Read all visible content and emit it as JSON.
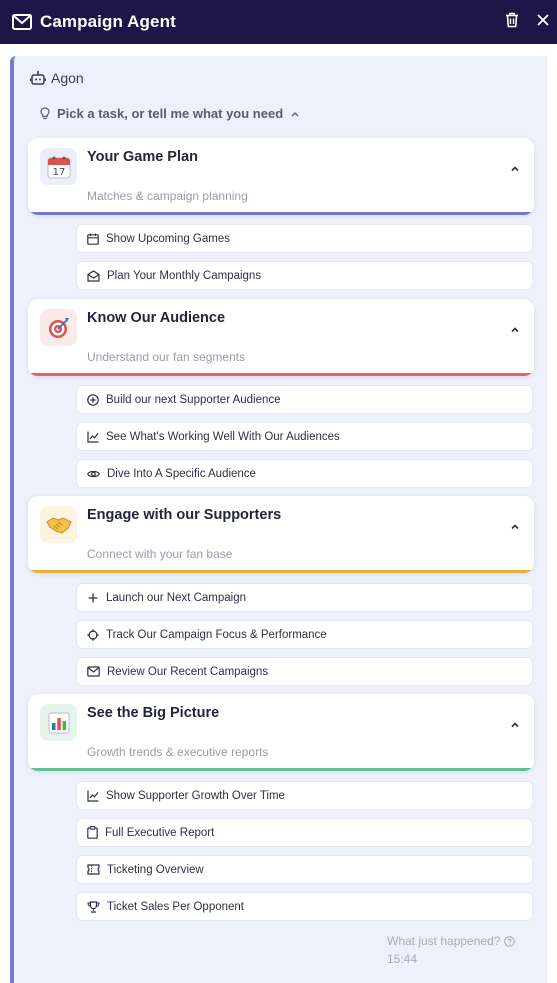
{
  "header": {
    "title": "Campaign Agent"
  },
  "agent": {
    "name": "Agon"
  },
  "picker": {
    "label": "Pick a task, or tell me what you need"
  },
  "sections": [
    {
      "title": "Your Game Plan",
      "subtitle": "Matches & campaign planning",
      "accent": "#7679d4",
      "icon": "calendar-icon",
      "items": [
        {
          "label": "Show Upcoming Games",
          "icon": "calendar-icon"
        },
        {
          "label": "Plan Your Monthly Campaigns",
          "icon": "mail-open-icon"
        }
      ]
    },
    {
      "title": "Know Our Audience",
      "subtitle": "Understand our fan segments",
      "accent": "#e0606b",
      "icon": "target-icon",
      "items": [
        {
          "label": "Build our next Supporter Audience",
          "icon": "plus-circle-icon"
        },
        {
          "label": "See What's Working Well With Our Audiences",
          "icon": "line-chart-icon"
        },
        {
          "label": "Dive Into A Specific Audience",
          "icon": "eye-icon"
        }
      ]
    },
    {
      "title": "Engage with our Supporters",
      "subtitle": "Connect with your fan base",
      "accent": "#e9b040",
      "icon": "handshake-icon",
      "items": [
        {
          "label": "Launch our Next Campaign",
          "icon": "plus-icon"
        },
        {
          "label": "Track Our Campaign Focus & Performance",
          "icon": "crosshair-icon"
        },
        {
          "label": "Review Our Recent Campaigns",
          "icon": "mail-icon"
        }
      ]
    },
    {
      "title": "See the Big Picture",
      "subtitle": "Growth trends & executive reports",
      "accent": "#5cc28e",
      "icon": "bar-chart-icon",
      "items": [
        {
          "label": "Show Supporter Growth Over Time",
          "icon": "line-chart-icon"
        },
        {
          "label": "Full Executive Report",
          "icon": "clipboard-icon"
        },
        {
          "label": "Ticketing Overview",
          "icon": "ticket-icon"
        },
        {
          "label": "Ticket Sales Per Opponent",
          "icon": "trophy-icon"
        }
      ]
    }
  ],
  "footer": {
    "question": "What just happened?",
    "time": "15:44"
  },
  "colors": {
    "header_bg": "#1d1646",
    "panel_bg": "#eef0fb",
    "panel_border": "#7679d4"
  }
}
